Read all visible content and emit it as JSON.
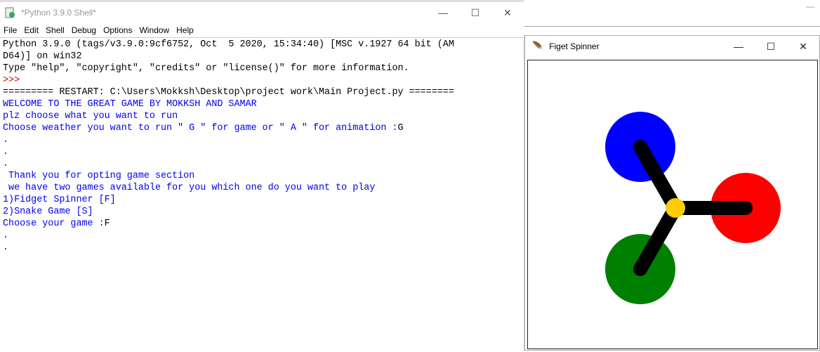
{
  "shell": {
    "title": "*Python 3.9.0 Shell*",
    "menu": [
      "File",
      "Edit",
      "Shell",
      "Debug",
      "Options",
      "Window",
      "Help"
    ],
    "lines": [
      {
        "t": "Python 3.9.0 (tags/v3.9.0:9cf6752, Oct  5 2020, 15:34:40) [MSC v.1927 64 bit (AM",
        "c": "k"
      },
      {
        "t": "D64)] on win32",
        "c": "k"
      },
      {
        "t": "Type \"help\", \"copyright\", \"credits\" or \"license()\" for more information.",
        "c": "k"
      },
      {
        "t": ">>> ",
        "c": "r"
      },
      {
        "t": "========= RESTART: C:\\Users\\Mokksh\\Desktop\\project work\\Main Project.py ========",
        "c": "k"
      },
      {
        "t": "WELCOME TO THE GREAT GAME BY MOKKSH AND SAMAR",
        "c": "b"
      },
      {
        "t": "plz choose what you want to run",
        "c": "b"
      },
      {
        "t": "Choose weather you want to run \" G \" for game or \" A \" for animation :",
        "c": "b",
        "input": "G"
      },
      {
        "t": ".",
        "c": "b"
      },
      {
        "t": ".",
        "c": "b"
      },
      {
        "t": ".",
        "c": "b"
      },
      {
        "t": " Thank you for opting game section",
        "c": "b"
      },
      {
        "t": " we have two games available for you which one do you want to play",
        "c": "b"
      },
      {
        "t": "1)Fidget Spinner [F]",
        "c": "b"
      },
      {
        "t": "2)Snake Game [S]",
        "c": "b"
      },
      {
        "t": "Choose your game :",
        "c": "b",
        "input": "F"
      },
      {
        "t": ".",
        "c": "b"
      },
      {
        "t": ".",
        "c": "b"
      }
    ]
  },
  "spinner": {
    "title": "Figet Spinner",
    "colors": {
      "top": "#0000ff",
      "right": "#ff0000",
      "bottom": "#008000",
      "hub": "#ffcc00",
      "arm": "#000000"
    }
  },
  "window_buttons": {
    "minimize": "—",
    "maximize": "☐",
    "close": "✕"
  }
}
